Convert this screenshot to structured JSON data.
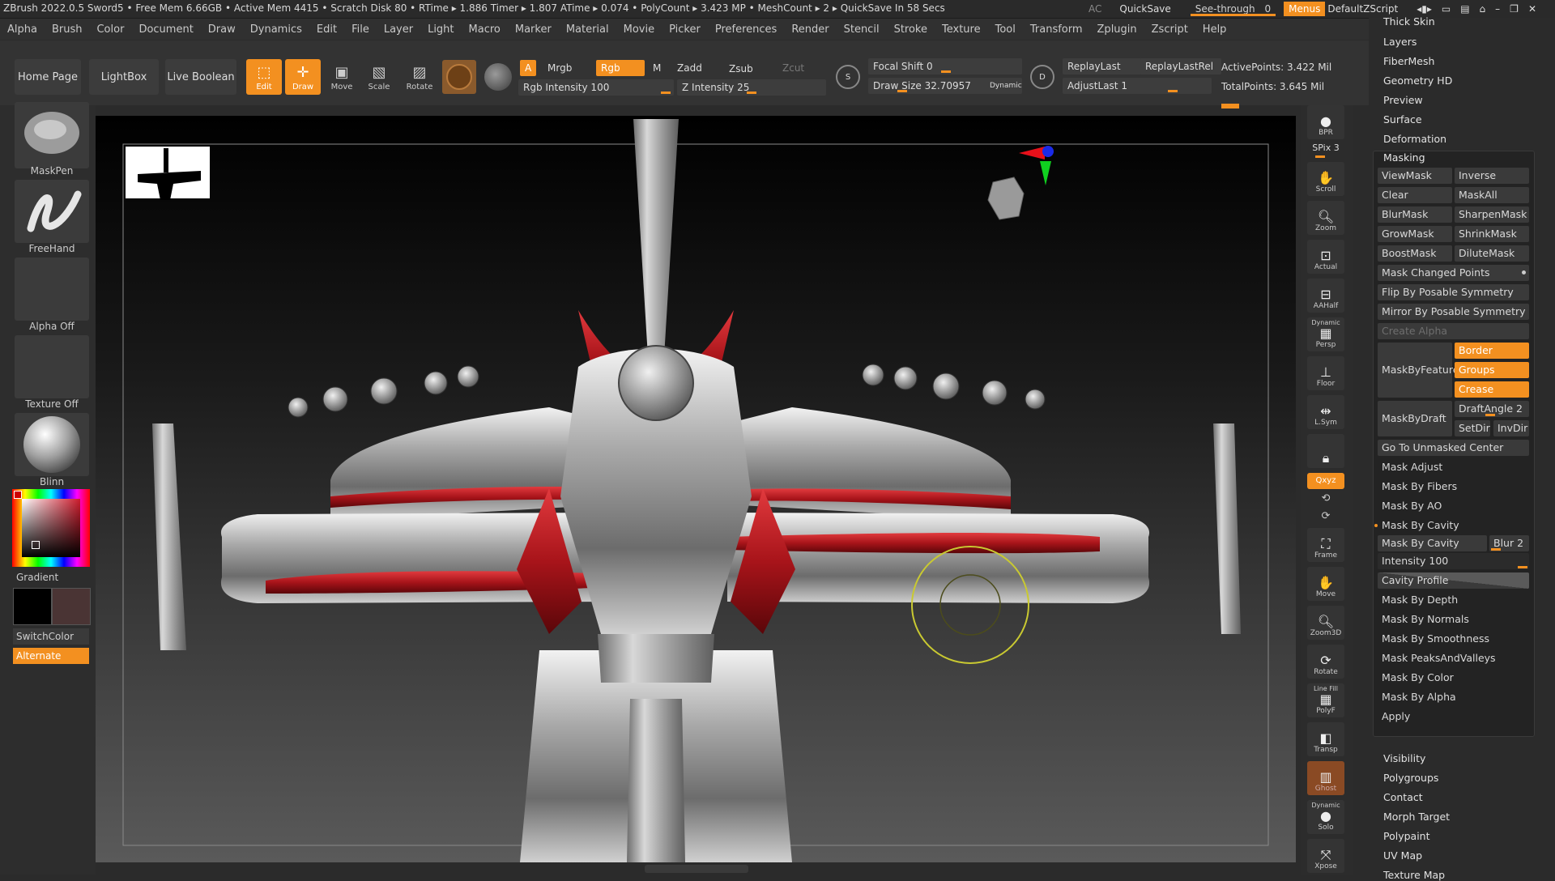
{
  "titlebar": {
    "status": "ZBrush 2022.0.5   Sword5   • Free Mem 6.66GB • Active Mem 4415 • Scratch Disk 80 • RTime ▸ 1.886 Timer ▸ 1.807 ATime ▸ 0.074 • PolyCount ▸ 3.423 MP  • MeshCount ▸ 2  ▸ QuickSave In 58 Secs",
    "ac": "AC",
    "quicksave": "QuickSave",
    "see_through_label": "See-through",
    "see_through_value": "0",
    "menus": "Menus",
    "script": "DefaultZScript"
  },
  "menubar": [
    "Alpha",
    "Brush",
    "Color",
    "Document",
    "Draw",
    "Dynamics",
    "Edit",
    "File",
    "Layer",
    "Light",
    "Macro",
    "Marker",
    "Material",
    "Movie",
    "Picker",
    "Preferences",
    "Render",
    "Stencil",
    "Stroke",
    "Texture",
    "Tool",
    "Transform",
    "Zplugin",
    "Zscript",
    "Help"
  ],
  "toolbar": {
    "home": "Home Page",
    "lightbox": "LightBox",
    "liveboolean": "Live Boolean",
    "edit": "Edit",
    "draw": "Draw",
    "move": "Move",
    "scale": "Scale",
    "rotate": "Rotate",
    "a": "A",
    "mrgb": "Mrgb",
    "rgb": "Rgb",
    "m": "M",
    "zadd": "Zadd",
    "zsub": "Zsub",
    "zcut": "Zcut",
    "rgb_intensity": "Rgb Intensity 100",
    "z_intensity": "Z Intensity 25",
    "focal_shift": "Focal Shift 0",
    "draw_size": "Draw Size 32.70957",
    "dynamic": "Dynamic",
    "replay_last": "ReplayLast",
    "replay_last_rel": "ReplayLastRel",
    "adjust_last": "AdjustLast 1",
    "active_points": "ActivePoints: 3.422 Mil",
    "total_points": "TotalPoints: 3.645 Mil",
    "s": "S",
    "d": "D"
  },
  "lefttray": {
    "brush": "MaskPen",
    "stroke": "FreeHand",
    "alpha": "Alpha Off",
    "texture": "Texture Off",
    "material": "Blinn",
    "gradient": "Gradient",
    "switchcolor": "SwitchColor",
    "alternate": "Alternate"
  },
  "rightdock": {
    "bpr": "BPR",
    "spix": "SPix 3",
    "scroll": "Scroll",
    "zoom": "Zoom",
    "actual": "Actual",
    "aahalf": "AAHalf",
    "persp_top": "Dynamic",
    "persp": "Persp",
    "floor": "Floor",
    "lsym": "L.Sym",
    "xyz": "Qxyz",
    "frame": "Frame",
    "move": "Move",
    "zoom3d": "Zoom3D",
    "rotate": "Rotate",
    "polyf_top": "Line Fill",
    "polyf": "PolyF",
    "transp": "Transp",
    "ghost": "Ghost",
    "solo_top": "Dynamic",
    "solo": "Solo",
    "xpose": "Xpose"
  },
  "palette": {
    "top_items": [
      "Thick Skin",
      "Layers",
      "FiberMesh",
      "Geometry HD",
      "Preview",
      "Surface",
      "Deformation"
    ],
    "masking_title": "Masking",
    "masking": {
      "viewmask": "ViewMask",
      "inverse": "Inverse",
      "clear": "Clear",
      "maskall": "MaskAll",
      "blurmask": "BlurMask",
      "sharpenmask": "SharpenMask",
      "growmask": "GrowMask",
      "shrinkmask": "ShrinkMask",
      "boostmask": "BoostMask",
      "dilutemask": "DiluteMask",
      "mask_changed_points": "Mask Changed Points",
      "flip": "Flip By Posable Symmetry",
      "mirror": "Mirror By Posable Symmetry",
      "create_alpha": "Create Alpha",
      "maskbyfeature": "MaskByFeature",
      "border": "Border",
      "groups": "Groups",
      "crease": "Crease",
      "maskbydraft": "MaskByDraft",
      "draftangle": "DraftAngle 2",
      "setdir": "SetDir",
      "invdir": "InvDir",
      "goto_unmasked": "Go To Unmasked Center",
      "mask_adjust": "Mask Adjust",
      "mask_by_fibers": "Mask By Fibers",
      "mask_by_ao": "Mask By AO",
      "mask_by_cavity_head": "Mask By Cavity",
      "mask_by_cavity": "Mask By Cavity",
      "blur": "Blur 2",
      "intensity": "Intensity 100",
      "cavity_profile": "Cavity Profile",
      "mask_by_depth": "Mask By Depth",
      "mask_by_normals": "Mask By Normals",
      "mask_by_smoothness": "Mask By Smoothness",
      "mask_peaks": "Mask PeaksAndValleys",
      "mask_by_color": "Mask By Color",
      "mask_by_alpha": "Mask By Alpha",
      "apply": "Apply"
    },
    "bottom_items": [
      "Visibility",
      "Polygroups",
      "Contact",
      "Morph Target",
      "Polypaint",
      "UV Map",
      "Texture Map"
    ]
  },
  "colors": {
    "accent": "#f39020",
    "mask_red": "#b3151b",
    "metal": "#b8b8b8",
    "primary_color": "#000000",
    "secondary_color": "#4a3434"
  }
}
